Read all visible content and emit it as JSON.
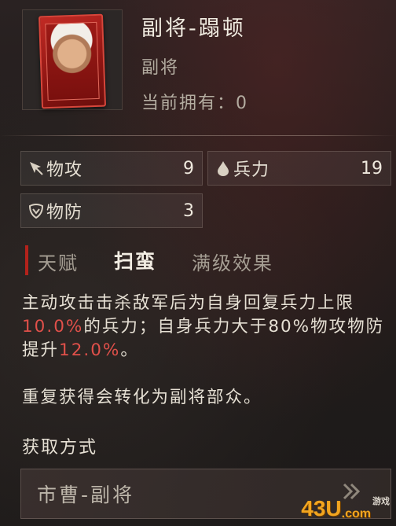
{
  "header": {
    "title": "副将-蹋顿",
    "subtype": "副将",
    "owned_label": "当前拥有：0"
  },
  "stats": [
    {
      "icon": "sword-cursor-icon",
      "name": "物攻",
      "value": "9"
    },
    {
      "icon": "water-drop-icon",
      "name": "兵力",
      "value": "19"
    },
    {
      "icon": "shield-icon",
      "name": "物防",
      "value": "3"
    }
  ],
  "talent": {
    "label": "天赋",
    "name": "扫蛮",
    "effect_label": "满级效果",
    "desc_1": "主动攻击击杀敌军后为自身回复兵力上限",
    "desc_hl_1": "10.0%",
    "desc_2": "的兵力；自身兵力大于80%物攻物防提升",
    "desc_hl_2": "12.0%",
    "desc_3": "。",
    "note": "重复获得会转化为副将部众。"
  },
  "acquire": {
    "title": "获取方式",
    "source_label": "市曹-副将",
    "arrow_icon": "double-chevron-right-icon"
  },
  "watermark": {
    "text": "43U",
    "suffix": ".com",
    "small": "游戏"
  },
  "colors": {
    "highlight": "#e0504a",
    "accent_red": "#b3221b",
    "card_red": "#c12a24"
  }
}
